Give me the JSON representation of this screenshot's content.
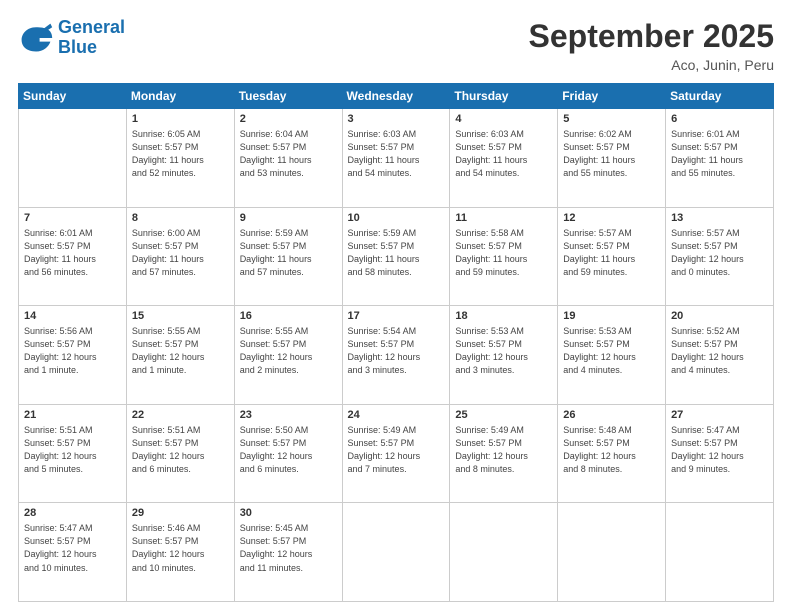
{
  "header": {
    "logo_line1": "General",
    "logo_line2": "Blue",
    "month": "September 2025",
    "location": "Aco, Junin, Peru"
  },
  "days_of_week": [
    "Sunday",
    "Monday",
    "Tuesday",
    "Wednesday",
    "Thursday",
    "Friday",
    "Saturday"
  ],
  "weeks": [
    [
      {
        "num": "",
        "info": ""
      },
      {
        "num": "1",
        "info": "Sunrise: 6:05 AM\nSunset: 5:57 PM\nDaylight: 11 hours\nand 52 minutes."
      },
      {
        "num": "2",
        "info": "Sunrise: 6:04 AM\nSunset: 5:57 PM\nDaylight: 11 hours\nand 53 minutes."
      },
      {
        "num": "3",
        "info": "Sunrise: 6:03 AM\nSunset: 5:57 PM\nDaylight: 11 hours\nand 54 minutes."
      },
      {
        "num": "4",
        "info": "Sunrise: 6:03 AM\nSunset: 5:57 PM\nDaylight: 11 hours\nand 54 minutes."
      },
      {
        "num": "5",
        "info": "Sunrise: 6:02 AM\nSunset: 5:57 PM\nDaylight: 11 hours\nand 55 minutes."
      },
      {
        "num": "6",
        "info": "Sunrise: 6:01 AM\nSunset: 5:57 PM\nDaylight: 11 hours\nand 55 minutes."
      }
    ],
    [
      {
        "num": "7",
        "info": "Sunrise: 6:01 AM\nSunset: 5:57 PM\nDaylight: 11 hours\nand 56 minutes."
      },
      {
        "num": "8",
        "info": "Sunrise: 6:00 AM\nSunset: 5:57 PM\nDaylight: 11 hours\nand 57 minutes."
      },
      {
        "num": "9",
        "info": "Sunrise: 5:59 AM\nSunset: 5:57 PM\nDaylight: 11 hours\nand 57 minutes."
      },
      {
        "num": "10",
        "info": "Sunrise: 5:59 AM\nSunset: 5:57 PM\nDaylight: 11 hours\nand 58 minutes."
      },
      {
        "num": "11",
        "info": "Sunrise: 5:58 AM\nSunset: 5:57 PM\nDaylight: 11 hours\nand 59 minutes."
      },
      {
        "num": "12",
        "info": "Sunrise: 5:57 AM\nSunset: 5:57 PM\nDaylight: 11 hours\nand 59 minutes."
      },
      {
        "num": "13",
        "info": "Sunrise: 5:57 AM\nSunset: 5:57 PM\nDaylight: 12 hours\nand 0 minutes."
      }
    ],
    [
      {
        "num": "14",
        "info": "Sunrise: 5:56 AM\nSunset: 5:57 PM\nDaylight: 12 hours\nand 1 minute."
      },
      {
        "num": "15",
        "info": "Sunrise: 5:55 AM\nSunset: 5:57 PM\nDaylight: 12 hours\nand 1 minute."
      },
      {
        "num": "16",
        "info": "Sunrise: 5:55 AM\nSunset: 5:57 PM\nDaylight: 12 hours\nand 2 minutes."
      },
      {
        "num": "17",
        "info": "Sunrise: 5:54 AM\nSunset: 5:57 PM\nDaylight: 12 hours\nand 3 minutes."
      },
      {
        "num": "18",
        "info": "Sunrise: 5:53 AM\nSunset: 5:57 PM\nDaylight: 12 hours\nand 3 minutes."
      },
      {
        "num": "19",
        "info": "Sunrise: 5:53 AM\nSunset: 5:57 PM\nDaylight: 12 hours\nand 4 minutes."
      },
      {
        "num": "20",
        "info": "Sunrise: 5:52 AM\nSunset: 5:57 PM\nDaylight: 12 hours\nand 4 minutes."
      }
    ],
    [
      {
        "num": "21",
        "info": "Sunrise: 5:51 AM\nSunset: 5:57 PM\nDaylight: 12 hours\nand 5 minutes."
      },
      {
        "num": "22",
        "info": "Sunrise: 5:51 AM\nSunset: 5:57 PM\nDaylight: 12 hours\nand 6 minutes."
      },
      {
        "num": "23",
        "info": "Sunrise: 5:50 AM\nSunset: 5:57 PM\nDaylight: 12 hours\nand 6 minutes."
      },
      {
        "num": "24",
        "info": "Sunrise: 5:49 AM\nSunset: 5:57 PM\nDaylight: 12 hours\nand 7 minutes."
      },
      {
        "num": "25",
        "info": "Sunrise: 5:49 AM\nSunset: 5:57 PM\nDaylight: 12 hours\nand 8 minutes."
      },
      {
        "num": "26",
        "info": "Sunrise: 5:48 AM\nSunset: 5:57 PM\nDaylight: 12 hours\nand 8 minutes."
      },
      {
        "num": "27",
        "info": "Sunrise: 5:47 AM\nSunset: 5:57 PM\nDaylight: 12 hours\nand 9 minutes."
      }
    ],
    [
      {
        "num": "28",
        "info": "Sunrise: 5:47 AM\nSunset: 5:57 PM\nDaylight: 12 hours\nand 10 minutes."
      },
      {
        "num": "29",
        "info": "Sunrise: 5:46 AM\nSunset: 5:57 PM\nDaylight: 12 hours\nand 10 minutes."
      },
      {
        "num": "30",
        "info": "Sunrise: 5:45 AM\nSunset: 5:57 PM\nDaylight: 12 hours\nand 11 minutes."
      },
      {
        "num": "",
        "info": ""
      },
      {
        "num": "",
        "info": ""
      },
      {
        "num": "",
        "info": ""
      },
      {
        "num": "",
        "info": ""
      }
    ]
  ]
}
